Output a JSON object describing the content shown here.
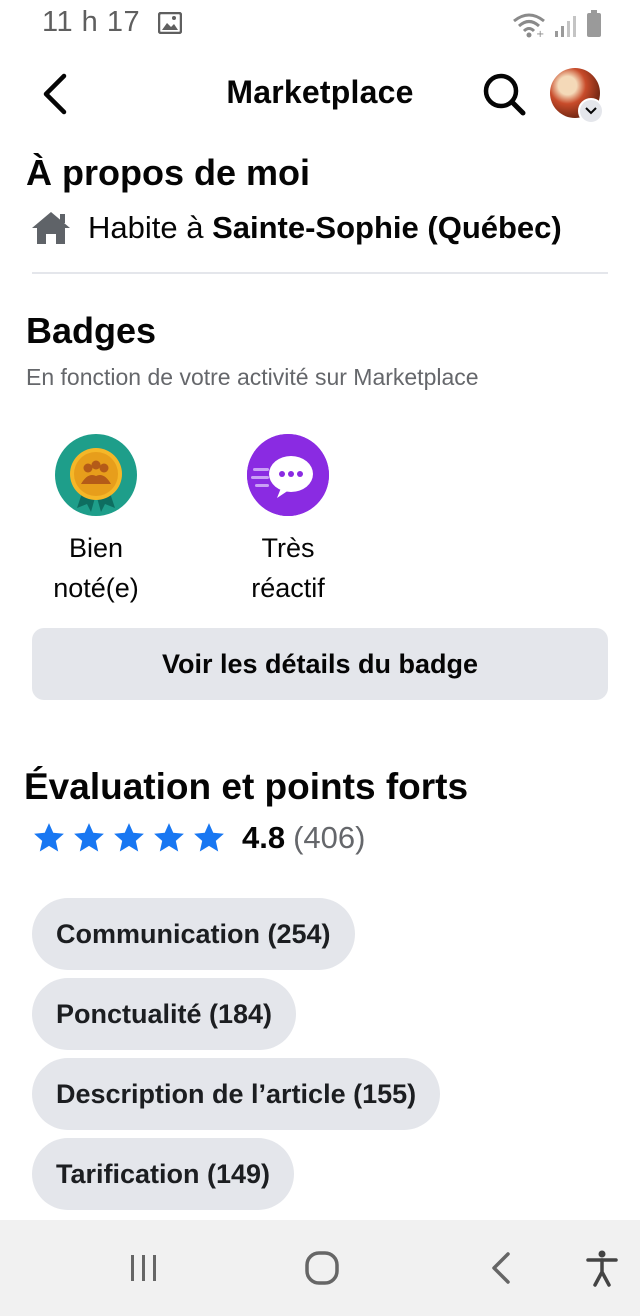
{
  "status_bar": {
    "time": "11 h 17"
  },
  "header": {
    "title": "Marketplace"
  },
  "about": {
    "title": "À propos de moi",
    "lives_prefix": "Habite à ",
    "lives_place": "Sainte-Sophie (Québec)"
  },
  "badges": {
    "title": "Badges",
    "subtitle": "En fonction de votre activité sur Marketplace",
    "items": [
      {
        "line1": "Bien",
        "line2": "noté(e)",
        "color": "#1e9e8a",
        "icon": "group-medal-icon"
      },
      {
        "line1": "Très",
        "line2": "réactif",
        "color": "#8a2be2",
        "icon": "chat-bubble-icon"
      }
    ],
    "details_button": "Voir les détails du badge"
  },
  "rating": {
    "title": "Évaluation et points forts",
    "stars": 5,
    "value": "4.8",
    "count": "(406)",
    "star_color": "#1877f2"
  },
  "highlights": [
    {
      "label": "Communication (254)"
    },
    {
      "label": "Ponctualité (184)"
    },
    {
      "label": "Description de l’article (155)"
    },
    {
      "label": "Tarification (149)"
    }
  ]
}
